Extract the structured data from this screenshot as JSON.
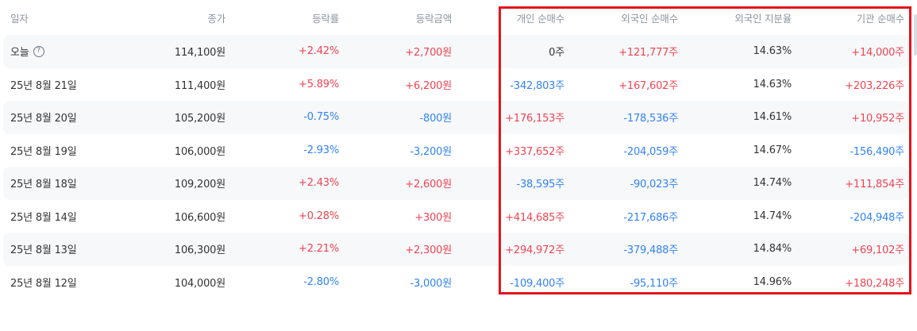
{
  "columns": {
    "date": "일자",
    "close": "종가",
    "rate": "등락률",
    "amount": "등락금액",
    "individual": "개인 순매수",
    "foreign": "외국인 순매수",
    "foreign_ratio": "외국인 지분율",
    "institution": "기관 순매수"
  },
  "help_icon": "question-circle-icon",
  "colors": {
    "positive": "#f04452",
    "negative": "#3182f6",
    "highlight": "#e3141b"
  },
  "rows": [
    {
      "date": "오늘",
      "close": "114,100원",
      "rate": "+2.42%",
      "amount": "+2,700원",
      "individual": "0주",
      "foreign": "+121,777주",
      "foreign_ratio": "14.63%",
      "institution": "+14,000주"
    },
    {
      "date": "25년 8월 21일",
      "close": "111,400원",
      "rate": "+5.89%",
      "amount": "+6,200원",
      "individual": "-342,803주",
      "foreign": "+167,602주",
      "foreign_ratio": "14.63%",
      "institution": "+203,226주"
    },
    {
      "date": "25년 8월 20일",
      "close": "105,200원",
      "rate": "-0.75%",
      "amount": "-800원",
      "individual": "+176,153주",
      "foreign": "-178,536주",
      "foreign_ratio": "14.61%",
      "institution": "+10,952주"
    },
    {
      "date": "25년 8월 19일",
      "close": "106,000원",
      "rate": "-2.93%",
      "amount": "-3,200원",
      "individual": "+337,652주",
      "foreign": "-204,059주",
      "foreign_ratio": "14.67%",
      "institution": "-156,490주"
    },
    {
      "date": "25년 8월 18일",
      "close": "109,200원",
      "rate": "+2.43%",
      "amount": "+2,600원",
      "individual": "-38,595주",
      "foreign": "-90,023주",
      "foreign_ratio": "14.74%",
      "institution": "+111,854주"
    },
    {
      "date": "25년 8월 14일",
      "close": "106,600원",
      "rate": "+0.28%",
      "amount": "+300원",
      "individual": "+414,685주",
      "foreign": "-217,686주",
      "foreign_ratio": "14.74%",
      "institution": "-204,948주"
    },
    {
      "date": "25년 8월 13일",
      "close": "106,300원",
      "rate": "+2.21%",
      "amount": "+2,300원",
      "individual": "+294,972주",
      "foreign": "-379,488주",
      "foreign_ratio": "14.84%",
      "institution": "+69,102주"
    },
    {
      "date": "25년 8월 12일",
      "close": "104,000원",
      "rate": "-2.80%",
      "amount": "-3,000원",
      "individual": "-109,400주",
      "foreign": "-95,110주",
      "foreign_ratio": "14.96%",
      "institution": "+180,248주"
    }
  ]
}
